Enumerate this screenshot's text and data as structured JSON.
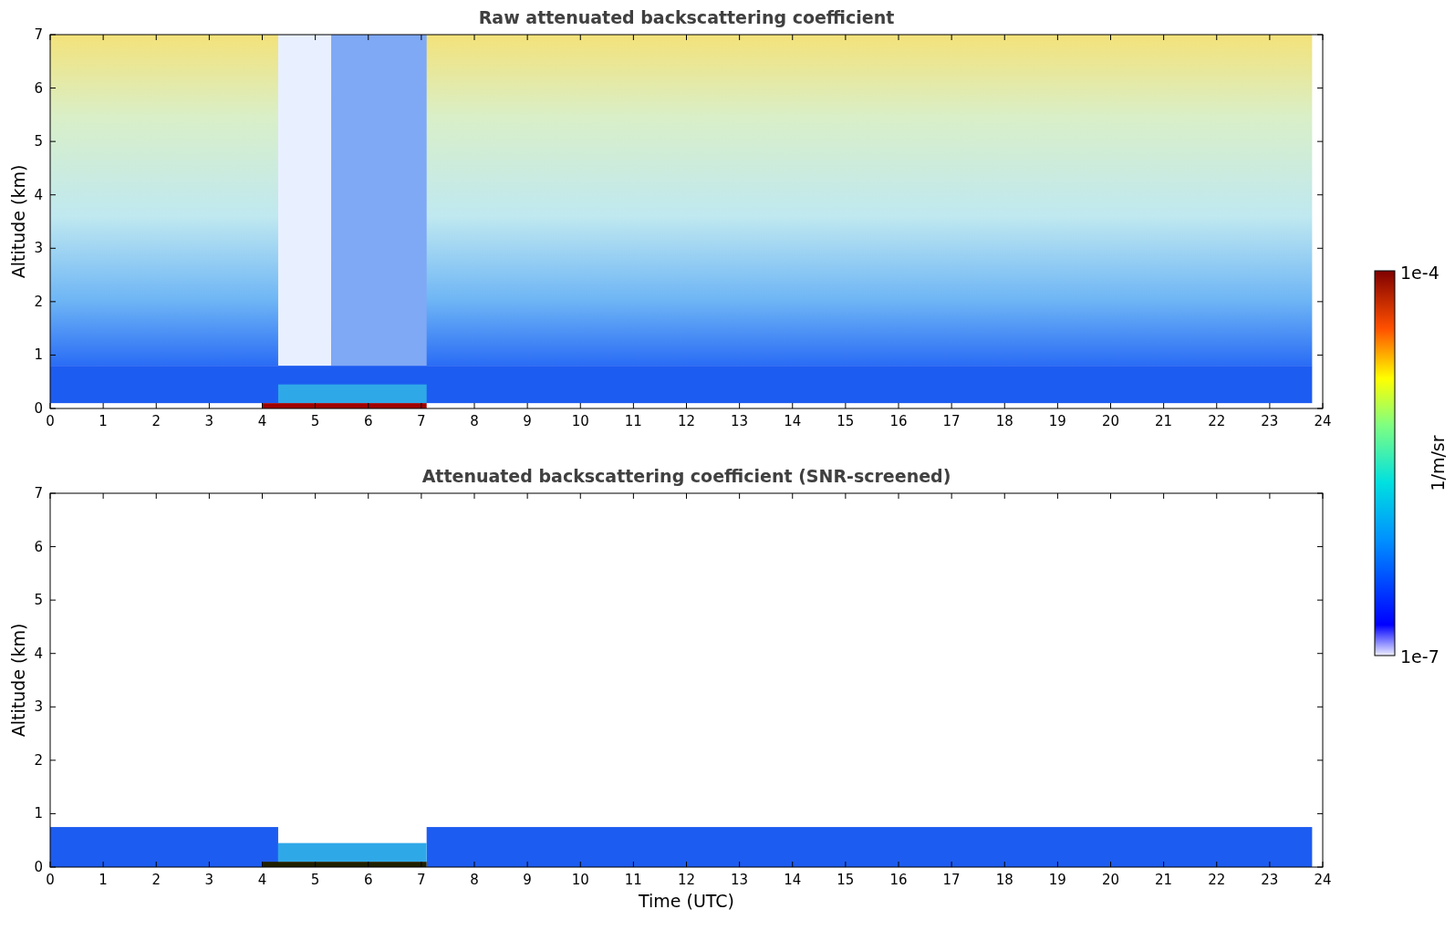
{
  "panels": [
    {
      "kind": "raw",
      "title": "Raw attenuated backscattering coefficient",
      "ylabel": "Altitude (km)",
      "yticks": [
        "7",
        "6",
        "5",
        "4",
        "3",
        "2",
        "1",
        "0"
      ],
      "xticks": [
        "0",
        "1",
        "2",
        "3",
        "4",
        "5",
        "6",
        "7",
        "8",
        "9",
        "10",
        "11",
        "12",
        "13",
        "14",
        "15",
        "16",
        "17",
        "18",
        "19",
        "20",
        "21",
        "22",
        "23",
        "24"
      ]
    },
    {
      "kind": "screened",
      "title": "Attenuated backscattering coefficient (SNR-screened)",
      "ylabel": "Altitude (km)",
      "xlabel": "Time (UTC)",
      "yticks": [
        "7",
        "6",
        "5",
        "4",
        "3",
        "2",
        "1",
        "0"
      ],
      "xticks": [
        "0",
        "1",
        "2",
        "3",
        "4",
        "5",
        "6",
        "7",
        "8",
        "9",
        "10",
        "11",
        "12",
        "13",
        "14",
        "15",
        "16",
        "17",
        "18",
        "19",
        "20",
        "21",
        "22",
        "23",
        "24"
      ]
    }
  ],
  "colorbar": {
    "label": "1/m/sr",
    "max_label": "1e-4",
    "min_label": "1e-7"
  }
}
